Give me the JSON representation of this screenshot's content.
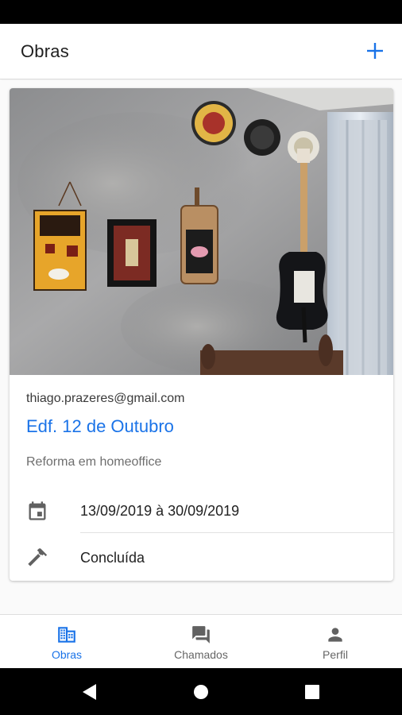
{
  "app_bar": {
    "title": "Obras",
    "add_icon": "plus-icon"
  },
  "colors": {
    "accent": "#1a73e8",
    "text_primary": "#222222",
    "text_secondary": "#6e6e6e",
    "status_bar": "#000000"
  },
  "obra_card": {
    "photo_icon": "photo-wall-decor",
    "owner_email": "thiago.prazeres@gmail.com",
    "name": "Edf. 12 de Outubro",
    "description": "Reforma em homeoffice",
    "period_icon": "calendar-icon",
    "period": "13/09/2019 à 30/09/2019",
    "status_icon": "hammer-icon",
    "status": "Concluída"
  },
  "bottom_nav": {
    "items": [
      {
        "label": "Obras",
        "icon": "building-icon",
        "active": true
      },
      {
        "label": "Chamados",
        "icon": "chat-icon",
        "active": false
      },
      {
        "label": "Perfil",
        "icon": "person-icon",
        "active": false
      }
    ]
  },
  "system_nav": [
    "back-icon",
    "home-icon",
    "recents-icon"
  ]
}
